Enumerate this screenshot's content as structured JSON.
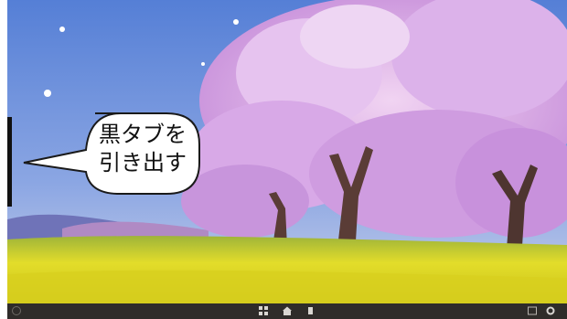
{
  "callout": {
    "line1": "黒タブを",
    "line2": "引き出す"
  },
  "taskbar": {
    "left_text": "",
    "center_icons": [
      "grid-icon",
      "home-icon",
      "back-icon"
    ],
    "right_icons": [
      "screenshot-icon",
      "settings-icon"
    ],
    "right_text": ""
  },
  "colors": {
    "sky": "#6d8fd6",
    "blossom": "#d7a6e6",
    "rapeseed": "#e4de2c",
    "taskbar": "#2f2c2a"
  }
}
